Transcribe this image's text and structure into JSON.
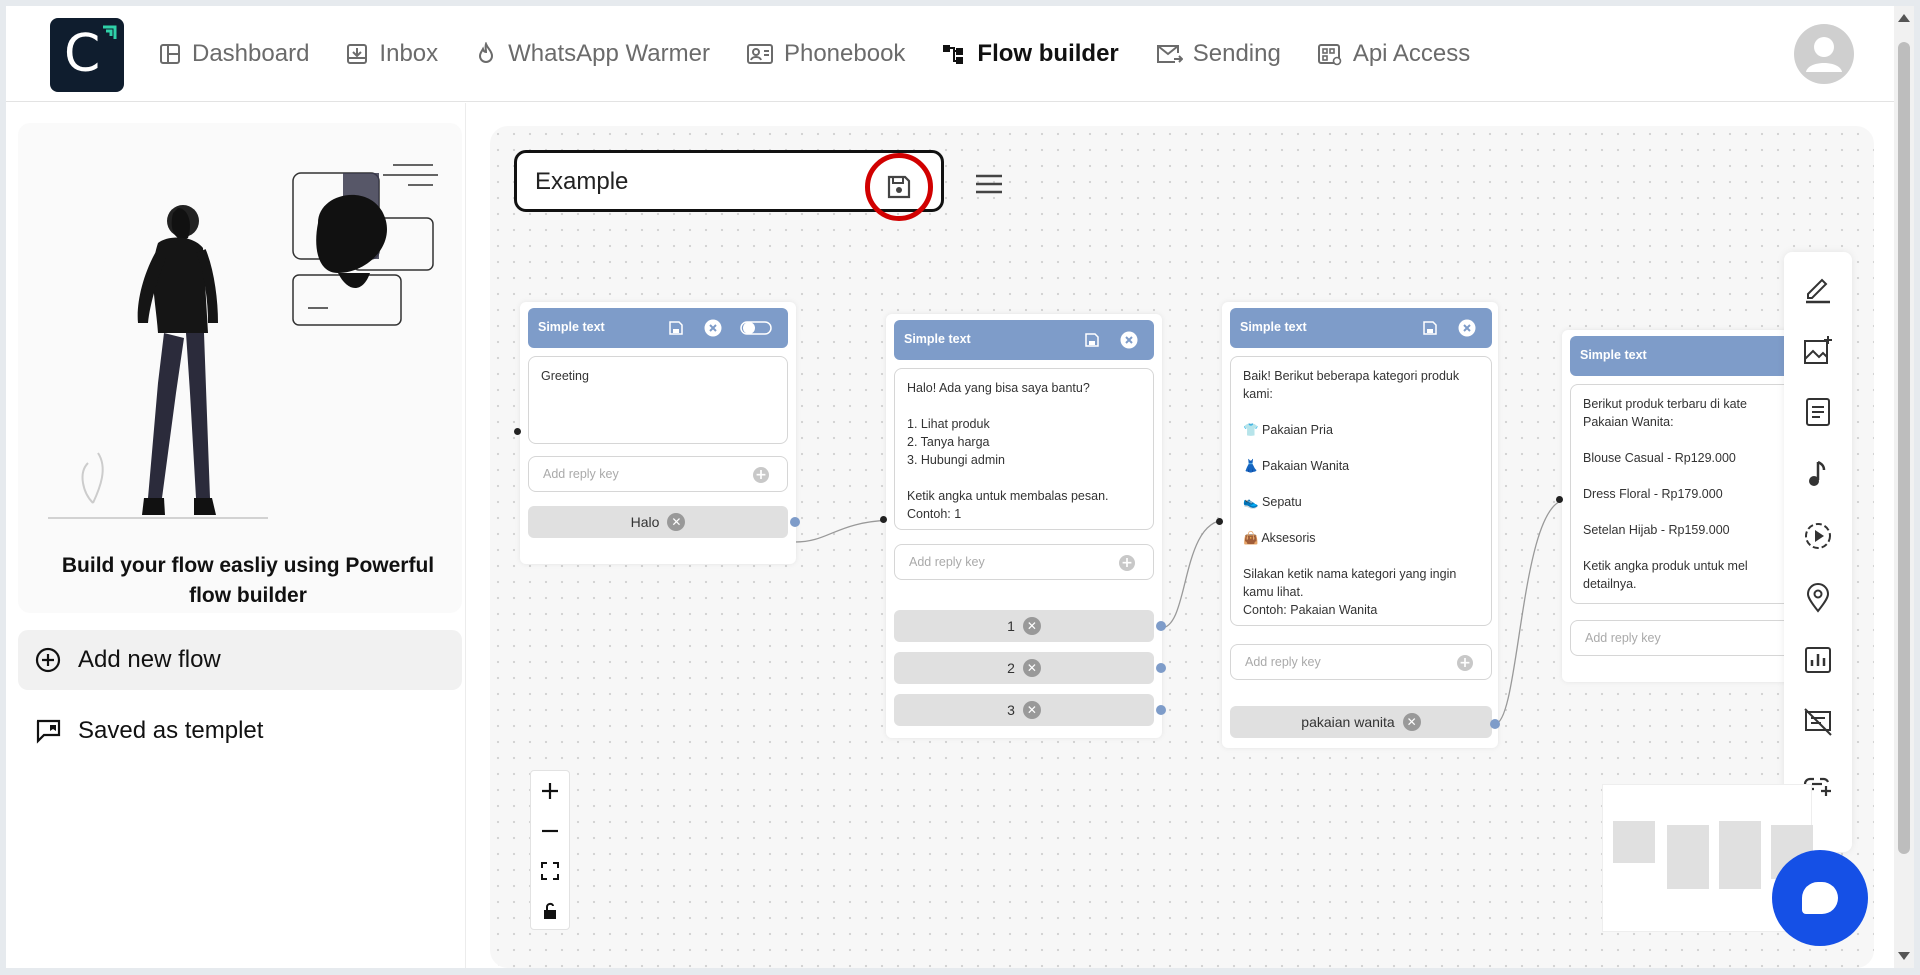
{
  "header": {
    "logo_letter": "C",
    "nav": [
      {
        "label": "Dashboard",
        "icon": "dashboard-icon",
        "active": false
      },
      {
        "label": "Inbox",
        "icon": "inbox-icon",
        "active": false
      },
      {
        "label": "WhatsApp Warmer",
        "icon": "flame-icon",
        "active": false
      },
      {
        "label": "Phonebook",
        "icon": "contact-card-icon",
        "active": false
      },
      {
        "label": "Flow builder",
        "icon": "flow-icon",
        "active": true
      },
      {
        "label": "Sending",
        "icon": "send-mail-icon",
        "active": false
      },
      {
        "label": "Api Access",
        "icon": "api-icon",
        "active": false
      }
    ]
  },
  "sidebar": {
    "promo_text": "Build your flow easliy using Powerful flow builder",
    "add_flow_label": "Add new flow",
    "saved_label": "Saved as templet"
  },
  "canvas": {
    "flow_name_value": "Example",
    "nodes": [
      {
        "title": "Simple text",
        "body": "Greeting",
        "reply_placeholder": "Add reply key",
        "keys": [
          "Halo"
        ]
      },
      {
        "title": "Simple text",
        "body": "Halo! Ada yang bisa saya bantu?\n\n1. Lihat produk\n2. Tanya harga\n3. Hubungi admin\n\nKetik angka untuk membalas pesan.\nContoh: 1",
        "reply_placeholder": "Add reply key",
        "keys": [
          "1",
          "2",
          "3"
        ]
      },
      {
        "title": "Simple text",
        "body": "Baik! Berikut beberapa kategori produk\nkami:\n\n👕 Pakaian Pria\n\n👗 Pakaian Wanita\n\n👟 Sepatu\n\n👜 Aksesoris\n\nSilakan ketik nama kategori yang ingin\nkamu lihat.\nContoh: Pakaian Wanita",
        "reply_placeholder": "Add reply key",
        "keys": [
          "pakaian wanita"
        ]
      },
      {
        "title": "Simple text",
        "body": "Berikut produk terbaru di kate\nPakaian Wanita:\n\nBlouse Casual - Rp129.000\n\nDress Floral - Rp179.000\n\nSetelan Hijab - Rp159.000\n\nKetik angka produk untuk mel\ndetailnya.",
        "reply_placeholder": "Add reply key",
        "keys": []
      }
    ]
  },
  "colors": {
    "node_header": "#7e9cc9",
    "save_highlight": "#d10000",
    "chat_button": "#1550e6",
    "logo_bg": "#0f1d2e"
  }
}
